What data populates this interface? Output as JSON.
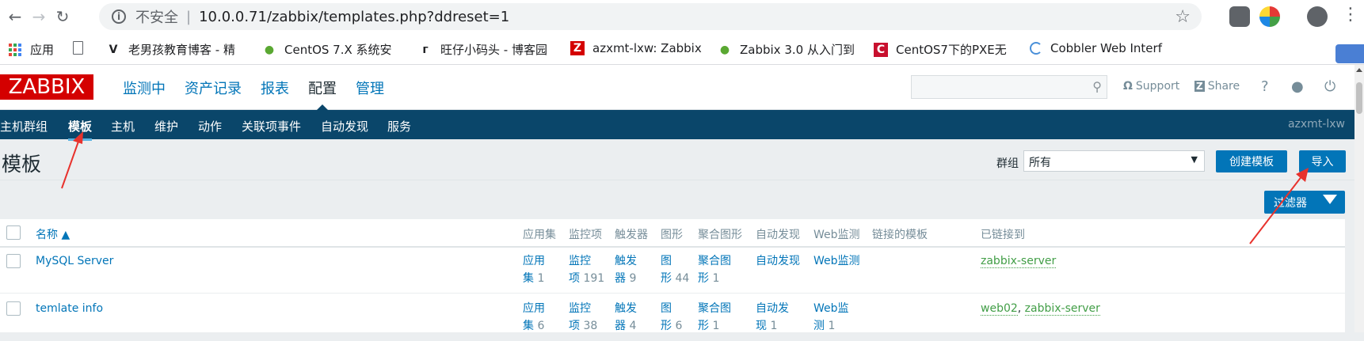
{
  "browser": {
    "insecure_label": "不安全",
    "url": "10.0.0.71/zabbix/templates.php?ddreset=1"
  },
  "bookmarks": [
    {
      "label": "应用",
      "icon": "apps-grid-icon"
    },
    {
      "label": "",
      "icon": "page-icon"
    },
    {
      "label": "老男孩教育博客 - 精",
      "icon": "v-logo-icon"
    },
    {
      "label": "CentOS 7.X 系统安",
      "icon": "frog-icon"
    },
    {
      "label": "旺仔小码头 - 博客园",
      "icon": "g-logo-icon"
    },
    {
      "label": "azxmt-lxw: Zabbix",
      "icon": "z-logo-icon"
    },
    {
      "label": "Zabbix 3.0 从入门到",
      "icon": "frog-icon"
    },
    {
      "label": "CentOS7下的PXE无",
      "icon": "c-logo-icon"
    },
    {
      "label": "Cobbler Web Interf",
      "icon": "cobbler-icon"
    }
  ],
  "zabbix": {
    "logo": "ZABBIX",
    "main_menu": [
      "监测中",
      "资产记录",
      "报表",
      "配置",
      "管理"
    ],
    "support": "Support",
    "share": "Share",
    "help": "?",
    "sub_menu": [
      "主机群组",
      "模板",
      "主机",
      "维护",
      "动作",
      "关联项事件",
      "自动发现",
      "服务"
    ],
    "username": "azxmt-lxw"
  },
  "page": {
    "title": "模板",
    "group_label": "群组",
    "group_value": "所有",
    "create_button": "创建模板",
    "import_button": "导入",
    "filter_button": "过滤器"
  },
  "table": {
    "headers": [
      "名称 ▲",
      "应用集",
      "监控项",
      "触发器",
      "图形",
      "聚合图形",
      "自动发现",
      "Web监测",
      "链接的模板",
      "已链接到"
    ],
    "rows": [
      {
        "name": "MySQL Server",
        "apps_a": "应用",
        "apps_b": "集",
        "apps_n": "1",
        "items_a": "监控",
        "items_b": "项",
        "items_n": "191",
        "triggers_a": "触发",
        "triggers_b": "器",
        "triggers_n": "9",
        "graphs_a": "图",
        "graphs_b": "形",
        "graphs_n": "44",
        "screens_a": "聚合图",
        "screens_b": "形",
        "screens_n": "1",
        "discovery_a": "自动发现",
        "discovery_b": "",
        "web_a": "Web监测",
        "web_b": "",
        "linked_to": "zabbix-server"
      },
      {
        "name": "temlate info",
        "apps_a": "应用",
        "apps_b": "集",
        "apps_n": "6",
        "items_a": "监控",
        "items_b": "项",
        "items_n": "38",
        "triggers_a": "触发",
        "triggers_b": "器",
        "triggers_n": "4",
        "graphs_a": "图",
        "graphs_b": "形",
        "graphs_n": "6",
        "screens_a": "聚合图",
        "screens_b": "形",
        "screens_n": "1",
        "discovery_a": "自动发",
        "discovery_b": "现",
        "discovery_n": "1",
        "web_a": "Web监",
        "web_b": "测",
        "web_n": "1",
        "linked_to_1": "web02",
        "linked_to_sep": ", ",
        "linked_to_2": "zabbix-server"
      }
    ]
  },
  "colors": {
    "accent": "#0275b8",
    "subnav": "#0a466a",
    "logo": "#d40000",
    "linked": "#429e47",
    "arrow": "#e8322d"
  }
}
